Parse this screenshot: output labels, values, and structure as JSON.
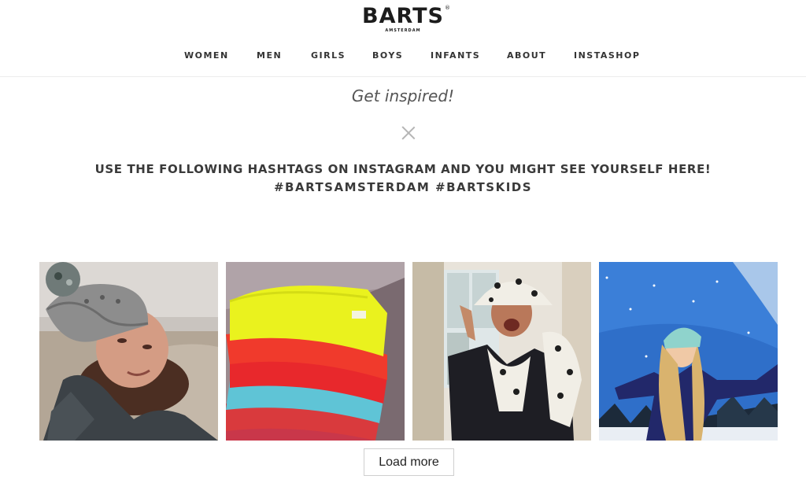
{
  "brand": {
    "name": "BARTS",
    "registered_mark": "®",
    "tagline": "AMSTERDAM"
  },
  "nav": {
    "items": [
      {
        "label": "WOMEN"
      },
      {
        "label": "MEN"
      },
      {
        "label": "GIRLS"
      },
      {
        "label": "BOYS"
      },
      {
        "label": "INFANTS"
      },
      {
        "label": "ABOUT"
      },
      {
        "label": "INSTASHOP"
      }
    ]
  },
  "main": {
    "subtitle": "Get inspired!",
    "headline": "USE THE FOLLOWING HASHTAGS ON INSTAGRAM AND YOU MIGHT SEE YOURSELF HERE!",
    "hashtags": "#BARTSAMSTERDAM #BARTSKIDS",
    "load_more_label": "Load more"
  },
  "gallery": {
    "photos": [
      {
        "subject": "woman in grey knit pompom beanie at the beach"
      },
      {
        "subject": "stack of colourful knit beanies"
      },
      {
        "subject": "woman in dalmatian print bucket hat and scarf"
      },
      {
        "subject": "woman in mint knit beanie in the snow"
      }
    ]
  },
  "colors": {
    "text": "#333333",
    "headline": "#3a3a3a",
    "divider": "#ececec",
    "button_border": "#cfcfcf"
  }
}
